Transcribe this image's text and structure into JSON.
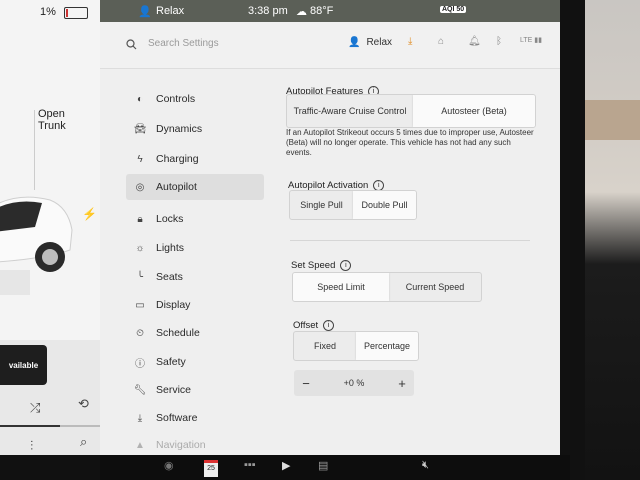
{
  "status": {
    "battery": "1%",
    "driver": "Relax",
    "time": "3:38 pm",
    "temperature": "88°F",
    "aqi": "AQI 50"
  },
  "search": {
    "placeholder": "Search Settings"
  },
  "profile": {
    "name": "Relax"
  },
  "car_panel": {
    "trunk_label": "Open\nTrunk",
    "banner": "vailable"
  },
  "sidebar": {
    "items": [
      {
        "label": "Controls",
        "icon": "toggle-icon"
      },
      {
        "label": "Dynamics",
        "icon": "car-icon"
      },
      {
        "label": "Charging",
        "icon": "bolt-icon"
      },
      {
        "label": "Autopilot",
        "icon": "steering-wheel-icon",
        "active": true
      },
      {
        "label": "Locks",
        "icon": "lock-icon"
      },
      {
        "label": "Lights",
        "icon": "sun-icon"
      },
      {
        "label": "Seats",
        "icon": "seat-icon"
      },
      {
        "label": "Display",
        "icon": "display-icon"
      },
      {
        "label": "Schedule",
        "icon": "clock-icon"
      },
      {
        "label": "Safety",
        "icon": "alert-icon"
      },
      {
        "label": "Service",
        "icon": "wrench-icon"
      },
      {
        "label": "Software",
        "icon": "download-icon"
      },
      {
        "label": "Navigation",
        "icon": "navigation-icon"
      }
    ]
  },
  "autopilot": {
    "features": {
      "title": "Autopilot Features",
      "options": [
        "Traffic-Aware Cruise Control",
        "Autosteer (Beta)"
      ],
      "selected": 1
    },
    "strikeout_note": "If an Autopilot Strikeout occurs 5 times due to improper use, Autosteer (Beta) will no longer operate. This vehicle has not had any such events.",
    "activation": {
      "title": "Autopilot Activation",
      "options": [
        "Single Pull",
        "Double Pull"
      ],
      "selected": 1
    },
    "set_speed": {
      "title": "Set Speed",
      "options": [
        "Speed Limit",
        "Current Speed"
      ],
      "selected": 0
    },
    "offset": {
      "title": "Offset",
      "options": [
        "Fixed",
        "Percentage"
      ],
      "selected": 1,
      "minus": "−",
      "value": "+0 %",
      "plus": "+"
    }
  },
  "colors": {
    "status_bar": "#5b5f57",
    "selected_segment": "#fafafa",
    "active_nav": "#dedede"
  }
}
